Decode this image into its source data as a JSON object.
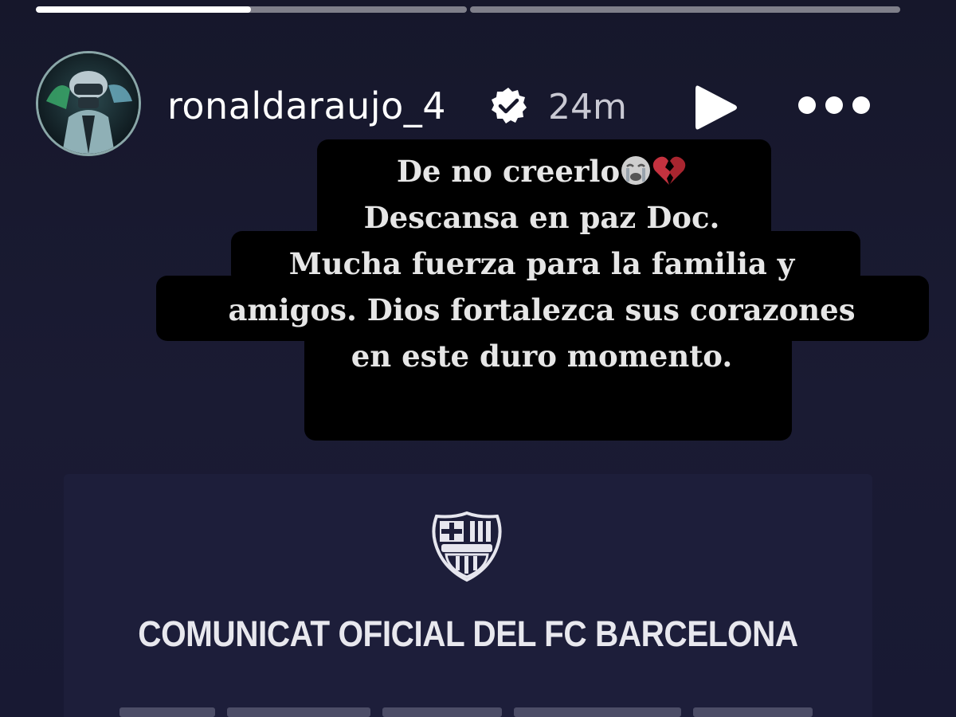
{
  "story": {
    "progress": [
      0.5,
      0.0
    ]
  },
  "header": {
    "username": "ronaldaraujo_4",
    "timestamp": "24m",
    "verified_icon": "verified-badge-icon",
    "play_icon": "play-icon",
    "more_icon": "more-options-icon"
  },
  "caption": {
    "line1": "De no creerlo",
    "line2": "Descansa en paz Doc.",
    "line3": "Mucha fuerza para la familia y",
    "line4": "amigos. Dios fortalezca sus corazones",
    "line5": "en este duro momento."
  },
  "card": {
    "crest_icon": "fc-barcelona-crest-icon",
    "title": "COMUNICAT OFICIAL DEL FC BARCELONA"
  },
  "colors": {
    "background": "#16172b",
    "card": "#1d1e3a",
    "caption_bg": "#000000",
    "text": "#ffffff"
  }
}
